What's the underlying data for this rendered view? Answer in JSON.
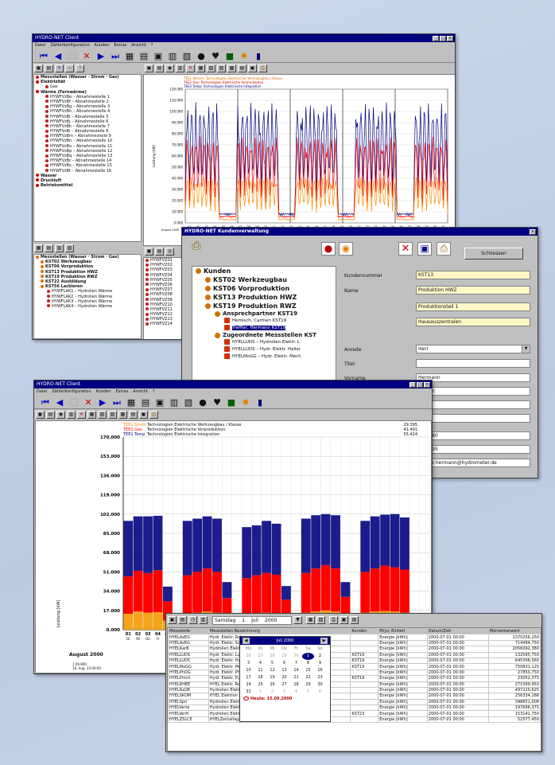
{
  "main_window": {
    "title": "HYDRO-NET Client",
    "menu": [
      "Datei",
      "Zählerkonfiguration",
      "Kunden",
      "Extras",
      "Ansicht",
      "?"
    ],
    "tree_items": [
      {
        "label": "Messstellen (Wasser · Strom · Gas)",
        "bold": true
      },
      {
        "label": "Elektrizität",
        "bold": true
      },
      {
        "label": "Gas",
        "bold": false
      },
      {
        "label": "Wärme (Fernwärme)",
        "bold": true
      },
      {
        "label": "HYWFVzBe – Abnahmestelle 1",
        "bold": false
      },
      {
        "label": "HYWFVzBf – Abnahmestelle 2",
        "bold": false
      },
      {
        "label": "HYWFVzBg – Abnahmestelle 3",
        "bold": false
      },
      {
        "label": "HYWFVzBh – Abnahmestelle 4",
        "bold": false
      },
      {
        "label": "HYWFVzBi – Abnahmestelle 5",
        "bold": false
      },
      {
        "label": "HYWFVzBj – Abnahmestelle 6",
        "bold": false
      },
      {
        "label": "HYWFVzBk – Abnahmestelle 7",
        "bold": false
      },
      {
        "label": "HYWFVzBl – Abnahmestelle 8",
        "bold": false
      },
      {
        "label": "HYWFVzBm – Abnahmestelle 9",
        "bold": false
      },
      {
        "label": "HYWFVzBn – Abnahmestelle 10",
        "bold": false
      },
      {
        "label": "HYWFVzBo – Abnahmestelle 11",
        "bold": false
      },
      {
        "label": "HYWFVzBp – Abnahmestelle 12",
        "bold": false
      },
      {
        "label": "HYWFVzBq – Abnahmestelle 13",
        "bold": false
      },
      {
        "label": "HYWFVzBr – Abnahmestelle 14",
        "bold": false
      },
      {
        "label": "HYWFVzBs – Abnahmestelle 15",
        "bold": false
      },
      {
        "label": "HYWFVzBt – Abnahmestelle 16",
        "bold": false
      },
      {
        "label": "Wasser",
        "bold": true
      },
      {
        "label": "Druckluft",
        "bold": true
      },
      {
        "label": "Betriebsmittel",
        "bold": true
      }
    ],
    "tree2_items": [
      {
        "label": "Messstellen (Wasser · Strom · Gas)",
        "bold": true
      },
      {
        "label": "KST02 Werkzeugbau",
        "bold": true
      },
      {
        "label": "KST06 Vorproduktion",
        "bold": true
      },
      {
        "label": "KST13 Produktion HWZ",
        "bold": true
      },
      {
        "label": "KST19 Produktion RWZ",
        "bold": true
      },
      {
        "label": "KST22 Ausbildung",
        "bold": true
      },
      {
        "label": "KST56 Lackieren",
        "bold": true
      },
      {
        "label": "HYWFLAK1 – Hydrolien Wärme",
        "bold": false
      },
      {
        "label": "HYWFLAK2 – Hydrolien Wärme",
        "bold": false
      },
      {
        "label": "HYWFLAK3 – Hydrolien Wärme",
        "bold": false
      },
      {
        "label": "HYWFLAK4 – Hydrolien Wärme",
        "bold": false
      }
    ],
    "list_items": [
      "HYWFVZ01",
      "HYWFVZ02",
      "HYWFVZ03",
      "HYWFVZ04",
      "HYWFVZ05",
      "HYWFVZ06",
      "HYWFVZ07",
      "HYWFVZ08",
      "HYWFVZ09",
      "HYWFVZ10",
      "HYWFVZ11",
      "HYWFVZ12",
      "HYWFVZ13",
      "HYWFVZ14"
    ],
    "legend": [
      "TEE1 Wiener: Technologien Elektrischer Werkzeugbau / Klasse",
      "TEE2 Gas: Technologien Elektrische Vorproduktion",
      "TEE3 Temp: Technologien Elektrische Integration"
    ],
    "chart_yticks": [
      "120.000",
      "110.000",
      "100.000",
      "90.000",
      "80.000",
      "70.000",
      "60.000",
      "50.000",
      "40.000",
      "30.000",
      "20.000",
      "10.000",
      "0.000"
    ],
    "chart_ylabel": "Leistung [kW]",
    "chart_xlabel": "August 2000"
  },
  "customer_window": {
    "title": "HYDRO-NET Kundenverwaltung",
    "close_label": "Schliessen",
    "tree": [
      {
        "label": "Kunden",
        "level": 0,
        "bold": true
      },
      {
        "label": "KST02 Werkzeugbau",
        "level": 1,
        "bold": true
      },
      {
        "label": "KST06 Vorproduktion",
        "level": 1,
        "bold": true
      },
      {
        "label": "KST13 Produktion HWZ",
        "level": 1,
        "bold": true
      },
      {
        "label": "KST19 Produktion RWZ",
        "level": 1,
        "bold": true
      },
      {
        "label": "Ansprechpartner KST19",
        "level": 2,
        "bold": true
      },
      {
        "label": "Hemisch, Carmen KST19",
        "level": 3,
        "bold": false
      },
      {
        "label": "Treffler, Hermann KST19",
        "level": 3,
        "bold": false,
        "selected": true
      },
      {
        "label": "Zugeordnete Messstellen KST",
        "level": 2,
        "bold": true
      },
      {
        "label": "HYELLUDS – Hydrolien Elektr. L",
        "level": 3,
        "bold": false
      },
      {
        "label": "HYELLUDS – Hydr. Elektr. Haller",
        "level": 3,
        "bold": false
      },
      {
        "label": "HYELMoGG – Hydr. Elektr. Mech",
        "level": 3,
        "bold": false
      }
    ],
    "fields": {
      "kundennummer_label": "Kundennummer",
      "kundennummer": "KST13",
      "name_label": "Name",
      "name": "Produktion HWZ",
      "extra1": "Produktionsteil 1",
      "extra2": "Hausauszentralen",
      "anrede_label": "Anrede",
      "anrede": "Herr",
      "titel_label": "Titel",
      "titel": "",
      "vorname_label": "Vorname",
      "vorname": "Hermann",
      "nachname": "Treffler",
      "telefon": "805 580",
      "fax": "805 595",
      "email": "treffler.hermann@hydrometer.de"
    }
  },
  "front_window": {
    "title": "HYDRO-NET Client",
    "menu": [
      "Datei",
      "Zählerkonfiguration",
      "Kunden",
      "Extras",
      "Ansicht",
      "?"
    ],
    "legend": [
      {
        "code": "TEE1 Strom",
        "text": "Technologien Elektrische Werkzeugbau / Klasse",
        "value": "29.395",
        "color": "#ff8c00"
      },
      {
        "code": "TEE1 Gas",
        "text": "Technologien Elektrische Vorproduktion",
        "value": "41.491",
        "color": "#ff0000"
      },
      {
        "code": "TEE1 Temp",
        "text": "Technologien Elektrische Integration",
        "value": "55.424",
        "color": "#000080"
      }
    ],
    "bottom_left": {
      "line1": "1.09.900",
      "line2": "18. Aug. 23:00:00"
    }
  },
  "table_window": {
    "date_day": "Samstag",
    "date_d": "1",
    "date_m": "Juli",
    "date_y": "2000",
    "columns": [
      "Messstelle",
      "Messstellen Bezeichnung",
      "Kunden",
      "Phys. Einheit",
      "Datum/Zeit",
      "Momentanwert"
    ],
    "rows": [
      [
        "HYELAzEG",
        "Hydr. Elektr. Rohre",
        "",
        "Energie [kWh]",
        "2000-07-01 00:00",
        "1370256,250"
      ],
      [
        "HYELAzEG",
        "Hydr. Elektr. Schleiferei",
        "",
        "Energie [kWh]",
        "2000-07-01 00:00",
        "714484,750"
      ],
      [
        "HYELKarB",
        "Hydrolien Elektr. Karosserie",
        "",
        "Energie [kWh]",
        "2000-07-01 00:00",
        "2056092,380"
      ],
      [
        "HYELLUDS",
        "Hydr. Elektr. Luft",
        "KST19",
        "Energie [kWh]",
        "2000-07-01 00:00",
        "132585,750"
      ],
      [
        "HYELLUDS",
        "Hydr. Elektr. Halle",
        "KST19",
        "Energie [kWh]",
        "2000-07-01 00:00",
        "645396,560"
      ],
      [
        "HYELMoGG",
        "Hydr. Elektr. Mech",
        "KST19",
        "Energie [kWh]",
        "2000-07-01 00:00",
        "750831,125"
      ],
      [
        "HYELPhOG",
        "Hydr. Elektr. Phos",
        "",
        "Energie [kWh]",
        "2000-07-01 00:00",
        "27850,750"
      ],
      [
        "HYELPmch",
        "Hydr. Elektr. Pumpe",
        "KST19",
        "Energie [kWh]",
        "2000-07-01 00:00",
        "23052,375"
      ],
      [
        "HYELRHEE",
        "HYEL Elektr. Rohre",
        "",
        "Energie [kWh]",
        "2000-07-01 00:00",
        "271589,950"
      ],
      [
        "HYELRxDE",
        "Hydrolien Elektr. Rohrleitung",
        "",
        "Energie [kWh]",
        "2000-07-01 00:00",
        "497220,625"
      ],
      [
        "HYELSKOM",
        "HYEL Elektron Preng MengeNV (MBF7)",
        "",
        "Energie [kWh]",
        "2000-07-01 00:00",
        "256334,188"
      ],
      [
        "HYELSpri",
        "Hydrolien Elektr Spritzstand (MV 2FT1)",
        "",
        "Energie [kWh]",
        "2000-07-01 00:00",
        "348851,008"
      ],
      [
        "HYELVerte",
        "Hydrolien Elektr Versorgung (M 2T7)",
        "",
        "Energie [kWh]",
        "2000-07-01 00:00",
        "197686,375"
      ],
      [
        "HYELVerH",
        "Hydrolien Elektr Versandsparhalle (M 3T56)",
        "KST23",
        "Energie [kWh]",
        "2000-07-01 00:00",
        "153141,750"
      ],
      [
        "HYELZ5LCE",
        "HYELZentallager str/Versandhalle (M5T4)",
        "",
        "Energie [kWh]",
        "2000-07-01 00:00",
        "52577,450"
      ]
    ],
    "calendar": {
      "month": "Juli 2000",
      "weekdays": [
        "Mo",
        "Di",
        "Mi",
        "Do",
        "Fr",
        "Sa",
        "So"
      ],
      "days": [
        "26",
        "27",
        "28",
        "29",
        "30",
        "1",
        "2",
        "3",
        "4",
        "5",
        "6",
        "7",
        "8",
        "9",
        "10",
        "11",
        "12",
        "13",
        "14",
        "15",
        "16",
        "17",
        "18",
        "19",
        "20",
        "21",
        "22",
        "23",
        "24",
        "25",
        "26",
        "27",
        "28",
        "29",
        "30",
        "31",
        "1",
        "2",
        "3",
        "4",
        "5",
        "6"
      ],
      "today": "Heute: 15.09.2000"
    }
  },
  "chart_data": [
    {
      "type": "line",
      "description_series": [
        "Strom",
        "Gas",
        "Temp"
      ],
      "ylim": [
        0,
        120000
      ],
      "yticks": [
        0,
        10000,
        20000,
        30000,
        40000,
        50000,
        60000,
        70000,
        80000,
        90000,
        100000,
        110000,
        120000
      ],
      "xlabel": "August 2000",
      "ylabel": "Leistung [kW]",
      "series": [
        {
          "color": "#000080",
          "pattern_peak": 105000
        },
        {
          "color": "#ff0000",
          "pattern_peak": 75000
        },
        {
          "color": "#ff8c00",
          "pattern_peak": 40000
        }
      ]
    },
    {
      "type": "bar",
      "stacked": true,
      "ylim": [
        0,
        170000
      ],
      "yticks": [
        "170.000",
        "153.000",
        "136.000",
        "119.000",
        "102.000",
        "85.000",
        "68.000",
        "51.000",
        "34.000",
        "17.000",
        "0.000"
      ],
      "ylabel": "Leistung [kW]",
      "xlabel": "August 2000",
      "categories": [
        "01",
        "02",
        "03",
        "04",
        "05",
        "06",
        "07",
        "08",
        "09",
        "10",
        "11",
        "12",
        "13",
        "14",
        "15",
        "16",
        "17",
        "18",
        "19",
        "20",
        "21",
        "22",
        "23",
        "24",
        "25",
        "26",
        "27",
        "28",
        "29",
        "30",
        "31"
      ],
      "weekday_labels": [
        "Di",
        "Mi",
        "Do",
        "Fr",
        "Sa"
      ],
      "series": [
        {
          "color": "#f5a31a",
          "values": [
            14000,
            16000,
            15000,
            15500,
            8000,
            3000,
            14000,
            15000,
            16000,
            15000,
            9000,
            3000,
            13500,
            14000,
            15000,
            14500,
            8500,
            3000,
            15000,
            16000,
            17000,
            16000,
            9000,
            3000,
            15000,
            16000,
            16500,
            16000,
            15000,
            0,
            0
          ]
        },
        {
          "color": "#ff0000",
          "values": [
            33000,
            36000,
            35000,
            37000,
            17000,
            6000,
            34000,
            36000,
            38000,
            36000,
            19000,
            6000,
            32000,
            34000,
            35000,
            34000,
            18000,
            6000,
            35000,
            38000,
            40000,
            38000,
            20000,
            6000,
            36000,
            38000,
            40000,
            39000,
            38000,
            0,
            0
          ]
        },
        {
          "color": "#1c1c8c",
          "values": [
            49000,
            48000,
            50000,
            48000,
            13000,
            4000,
            48000,
            47000,
            46000,
            47000,
            14000,
            4000,
            45000,
            44000,
            46000,
            45000,
            12000,
            4000,
            48000,
            47000,
            45000,
            47000,
            13000,
            4000,
            45000,
            46000,
            45000,
            47000,
            46000,
            0,
            0
          ]
        }
      ]
    }
  ]
}
